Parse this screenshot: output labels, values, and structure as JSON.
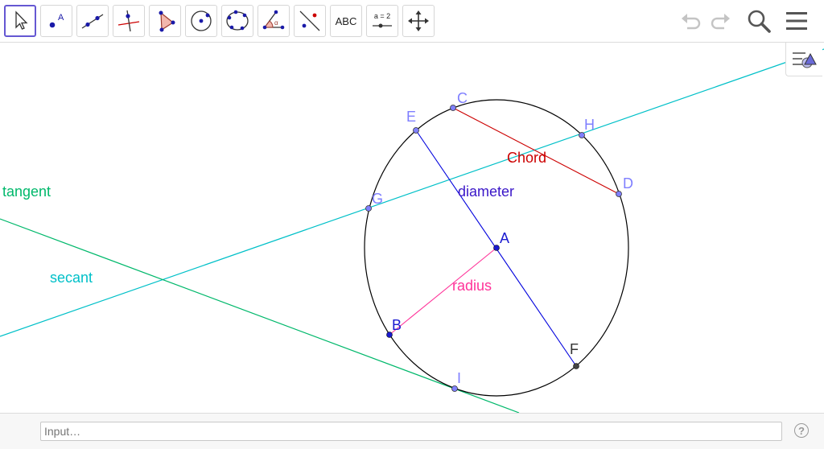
{
  "toolbar": {
    "tools": [
      {
        "name": "move-tool",
        "icon": "cursor-arrow-icon"
      },
      {
        "name": "point-tool",
        "icon": "point-icon",
        "label": "A"
      },
      {
        "name": "line-tool",
        "icon": "line-icon"
      },
      {
        "name": "perpendicular-tool",
        "icon": "perpendicular-line-icon"
      },
      {
        "name": "polygon-tool",
        "icon": "polygon-icon"
      },
      {
        "name": "circle-center-point-tool",
        "icon": "circle-center-icon"
      },
      {
        "name": "conic-five-points-tool",
        "icon": "conic-five-points-icon"
      },
      {
        "name": "angle-tool",
        "icon": "angle-icon",
        "label": "α"
      },
      {
        "name": "reflect-tool",
        "icon": "reflect-about-line-icon"
      },
      {
        "name": "text-tool",
        "icon": "text-icon",
        "label": "ABC"
      },
      {
        "name": "slider-tool",
        "icon": "slider-icon",
        "label": "a = 2"
      },
      {
        "name": "move-graphics-view-tool",
        "icon": "move-arrows-icon"
      }
    ],
    "undo_icon": "undo-icon",
    "redo_icon": "redo-icon",
    "search_icon": "search-icon",
    "menu_icon": "hamburger-menu-icon"
  },
  "graphics": {
    "labels": {
      "tangent": "tangent",
      "secant": "secant",
      "chord": "Chord",
      "diameter": "diameter",
      "radius": "radius"
    },
    "points": {
      "A": "A",
      "B": "B",
      "C": "C",
      "D": "D",
      "E": "E",
      "F": "F",
      "G": "G",
      "H": "H",
      "I": "I"
    },
    "colors": {
      "circle": "#000000",
      "chord": "#cc0000",
      "diameter": "#0000dd",
      "radius": "#ff3399",
      "secant": "#00c0c8",
      "tangent": "#00b86b",
      "point_label": "#7f7fff"
    }
  },
  "algebra_toggle_icon": "algebra-view-toggle-icon",
  "input": {
    "placeholder": "Input…"
  },
  "help_icon": "help-icon",
  "help_text": "?"
}
